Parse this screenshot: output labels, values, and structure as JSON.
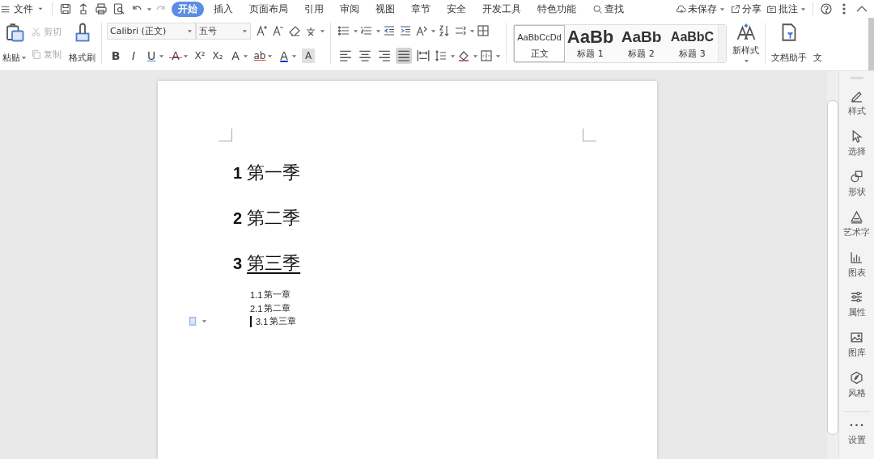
{
  "menu": {
    "file": "文件",
    "tabs": [
      {
        "label": "开始",
        "selected": true
      },
      {
        "label": "插入",
        "selected": false
      },
      {
        "label": "页面布局",
        "selected": false
      },
      {
        "label": "引用",
        "selected": false
      },
      {
        "label": "审阅",
        "selected": false
      },
      {
        "label": "视图",
        "selected": false
      },
      {
        "label": "章节",
        "selected": false
      },
      {
        "label": "安全",
        "selected": false
      },
      {
        "label": "开发工具",
        "selected": false
      },
      {
        "label": "特色功能",
        "selected": false
      }
    ],
    "search": "查找",
    "actions": [
      {
        "label": "未保存",
        "kind": "cloud"
      },
      {
        "label": "分享",
        "kind": "share"
      },
      {
        "label": "批注",
        "kind": "comment"
      }
    ]
  },
  "ribbon": {
    "paste": "粘贴",
    "cut": {
      "label": "剪切",
      "disabled": true
    },
    "copy": {
      "label": "复制",
      "disabled": true
    },
    "format_painter": "格式刷",
    "font": "Calibri (正文)",
    "size": "五号",
    "font_buttons": [
      {
        "label": "B",
        "kind": "bold",
        "dropdown": false
      },
      {
        "label": "I",
        "kind": "italic",
        "dropdown": false
      },
      {
        "label": "U",
        "kind": "underline",
        "dropdown": true
      },
      {
        "label": "A",
        "kind": "strike",
        "dropdown": true
      },
      {
        "label": "X²",
        "kind": "sup",
        "dropdown": false
      },
      {
        "label": "X₂",
        "kind": "sub",
        "dropdown": false
      },
      {
        "label": "A",
        "kind": "effect",
        "dropdown": true
      },
      {
        "label": "ab",
        "kind": "highlight",
        "dropdown": true
      },
      {
        "label": "A",
        "kind": "color",
        "dropdown": true
      },
      {
        "label": "A",
        "kind": "shade",
        "dropdown": false
      }
    ],
    "align": [
      {
        "kind": "left",
        "selected": false
      },
      {
        "kind": "center",
        "selected": false
      },
      {
        "kind": "right",
        "selected": false
      },
      {
        "kind": "justify",
        "selected": true
      },
      {
        "kind": "distribute",
        "selected": false
      }
    ],
    "styles": [
      {
        "sample": "AaBbCcDd",
        "label": "正文",
        "kind": "normal",
        "selected": true
      },
      {
        "sample": "AaBb",
        "label": "标题 1",
        "kind": "h1",
        "selected": false
      },
      {
        "sample": "AaBb",
        "label": "标题 2",
        "kind": "h2",
        "selected": false
      },
      {
        "sample": "AaBbC",
        "label": "标题 3",
        "kind": "h3",
        "selected": false
      }
    ],
    "new_style": "新样式",
    "assistant": "文档助手",
    "cut_off": "文"
  },
  "document": {
    "headings": [
      {
        "number": "1",
        "text": "第一季",
        "underlined": false
      },
      {
        "number": "2",
        "text": "第二季",
        "underlined": false
      },
      {
        "number": "3",
        "text": "第三季",
        "underlined": true
      }
    ],
    "items": [
      {
        "number": "1.1",
        "text": "第一章",
        "cursor": false
      },
      {
        "number": "2.1",
        "text": "第二章",
        "cursor": false
      },
      {
        "number": "3.1",
        "text": "第三章",
        "cursor": true
      }
    ]
  },
  "sidebar": [
    {
      "label": "样式",
      "kind": "pen"
    },
    {
      "label": "选择",
      "kind": "pointer"
    },
    {
      "label": "形状",
      "kind": "shape"
    },
    {
      "label": "艺术字",
      "kind": "art"
    },
    {
      "label": "图表",
      "kind": "chart"
    },
    {
      "label": "属性",
      "kind": "sliders"
    },
    {
      "label": "图库",
      "kind": "image"
    },
    {
      "label": "风格",
      "kind": "style"
    },
    {
      "label": "设置",
      "kind": "dots"
    }
  ]
}
